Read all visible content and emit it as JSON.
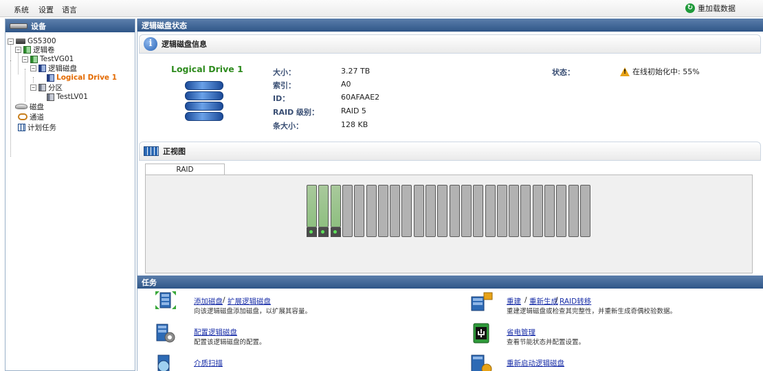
{
  "menu": {
    "items": [
      "系统",
      "设置",
      "语言"
    ],
    "reload": "重加载数据"
  },
  "left_panel": {
    "title": "设备",
    "tree": {
      "root": "GS5300",
      "volume": "逻辑卷",
      "vg": "TestVG01",
      "logical_disk": "逻辑磁盘",
      "selected": "Logical Drive 1",
      "partition": "分区",
      "lv": "TestLV01",
      "disk": "磁盘",
      "channel": "通道",
      "scheduled": "计划任务"
    }
  },
  "right_panel": {
    "title": "逻辑磁盘状态",
    "info_section": "逻辑磁盘信息",
    "drive_name": "Logical Drive 1",
    "props": [
      {
        "label": "大小：",
        "value": "3.27 TB"
      },
      {
        "label": "索引：",
        "value": "A0"
      },
      {
        "label": "ID：",
        "value": "60AFAAE2"
      },
      {
        "label": "RAID 级别：",
        "value": "RAID 5"
      },
      {
        "label": "条大小：",
        "value": "128 KB"
      }
    ],
    "state_label": "状态：",
    "state_value": "在线初始化中: 55%",
    "front_section": "正视图",
    "tab": "RAID",
    "enclosure": {
      "slot_count": 24,
      "active_slots": 3
    },
    "tasks_title": "任务",
    "tasks": {
      "add_disk": "添加磁盘",
      "sep": "/",
      "expand": "扩展逻辑磁盘",
      "add_desc": "向该逻辑磁盘添加磁盘，以扩展其容量。",
      "config": "配置逻辑磁盘",
      "config_desc": "配置该逻辑磁盘的配置。",
      "scan": "介质扫描",
      "rebuild": "重建",
      "regen": "重新生成",
      "raid_migrate": "RAID转移",
      "rebuild_desc": "重建逻辑磁盘或检查其完整性，并重新生成奇偶校验数据。",
      "power": "省电管理",
      "power_desc": "查看节能状态并配置设置。",
      "restart": "重新启动逻辑磁盘"
    }
  }
}
